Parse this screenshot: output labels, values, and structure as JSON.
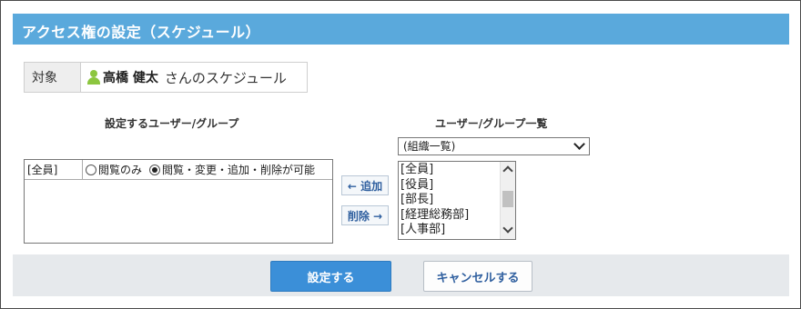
{
  "dialog": {
    "title": "アクセス権の設定（スケジュール）"
  },
  "target": {
    "label": "対象",
    "user_name": "高橋 健太",
    "suffix": "さんのスケジュール"
  },
  "settings": {
    "title": "設定するユーザー/グループ",
    "rows": [
      {
        "name": "[全員]",
        "options": [
          {
            "label": "閲覧のみ",
            "checked": false
          },
          {
            "label": "閲覧・変更・追加・削除が可能",
            "checked": true
          }
        ]
      }
    ]
  },
  "move_buttons": {
    "add_label": "← 追加",
    "remove_label": "削除 →"
  },
  "user_group_list": {
    "title": "ユーザー/グループ一覧",
    "selected_group": "(組織一覧)",
    "items": [
      "[全員]",
      "[役員]",
      "[部長]",
      "[経理総務部]",
      "[人事部]"
    ]
  },
  "footer": {
    "confirm_label": "設定する",
    "cancel_label": "キャンセルする"
  },
  "colors": {
    "header_bg": "#5aa9dc",
    "primary_button": "#3b8fd8",
    "user_icon": "#8cc63f",
    "footer_bg": "#e6e9ec"
  }
}
